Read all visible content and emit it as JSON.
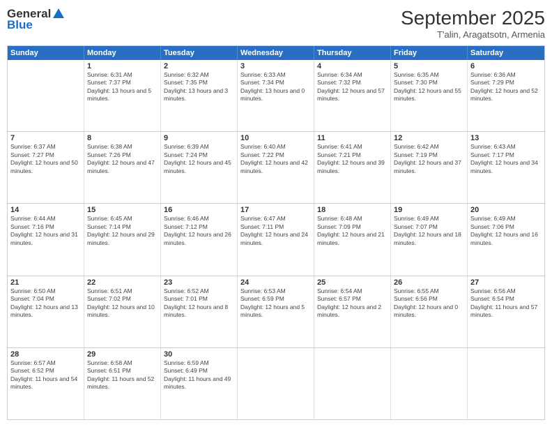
{
  "logo": {
    "general": "General",
    "blue": "Blue"
  },
  "title": "September 2025",
  "subtitle": "T'alin, Aragatsotn, Armenia",
  "days": [
    "Sunday",
    "Monday",
    "Tuesday",
    "Wednesday",
    "Thursday",
    "Friday",
    "Saturday"
  ],
  "weeks": [
    [
      {
        "num": "",
        "sunrise": "",
        "sunset": "",
        "daylight": ""
      },
      {
        "num": "1",
        "sunrise": "Sunrise: 6:31 AM",
        "sunset": "Sunset: 7:37 PM",
        "daylight": "Daylight: 13 hours and 5 minutes."
      },
      {
        "num": "2",
        "sunrise": "Sunrise: 6:32 AM",
        "sunset": "Sunset: 7:35 PM",
        "daylight": "Daylight: 13 hours and 3 minutes."
      },
      {
        "num": "3",
        "sunrise": "Sunrise: 6:33 AM",
        "sunset": "Sunset: 7:34 PM",
        "daylight": "Daylight: 13 hours and 0 minutes."
      },
      {
        "num": "4",
        "sunrise": "Sunrise: 6:34 AM",
        "sunset": "Sunset: 7:32 PM",
        "daylight": "Daylight: 12 hours and 57 minutes."
      },
      {
        "num": "5",
        "sunrise": "Sunrise: 6:35 AM",
        "sunset": "Sunset: 7:30 PM",
        "daylight": "Daylight: 12 hours and 55 minutes."
      },
      {
        "num": "6",
        "sunrise": "Sunrise: 6:36 AM",
        "sunset": "Sunset: 7:29 PM",
        "daylight": "Daylight: 12 hours and 52 minutes."
      }
    ],
    [
      {
        "num": "7",
        "sunrise": "Sunrise: 6:37 AM",
        "sunset": "Sunset: 7:27 PM",
        "daylight": "Daylight: 12 hours and 50 minutes."
      },
      {
        "num": "8",
        "sunrise": "Sunrise: 6:38 AM",
        "sunset": "Sunset: 7:26 PM",
        "daylight": "Daylight: 12 hours and 47 minutes."
      },
      {
        "num": "9",
        "sunrise": "Sunrise: 6:39 AM",
        "sunset": "Sunset: 7:24 PM",
        "daylight": "Daylight: 12 hours and 45 minutes."
      },
      {
        "num": "10",
        "sunrise": "Sunrise: 6:40 AM",
        "sunset": "Sunset: 7:22 PM",
        "daylight": "Daylight: 12 hours and 42 minutes."
      },
      {
        "num": "11",
        "sunrise": "Sunrise: 6:41 AM",
        "sunset": "Sunset: 7:21 PM",
        "daylight": "Daylight: 12 hours and 39 minutes."
      },
      {
        "num": "12",
        "sunrise": "Sunrise: 6:42 AM",
        "sunset": "Sunset: 7:19 PM",
        "daylight": "Daylight: 12 hours and 37 minutes."
      },
      {
        "num": "13",
        "sunrise": "Sunrise: 6:43 AM",
        "sunset": "Sunset: 7:17 PM",
        "daylight": "Daylight: 12 hours and 34 minutes."
      }
    ],
    [
      {
        "num": "14",
        "sunrise": "Sunrise: 6:44 AM",
        "sunset": "Sunset: 7:16 PM",
        "daylight": "Daylight: 12 hours and 31 minutes."
      },
      {
        "num": "15",
        "sunrise": "Sunrise: 6:45 AM",
        "sunset": "Sunset: 7:14 PM",
        "daylight": "Daylight: 12 hours and 29 minutes."
      },
      {
        "num": "16",
        "sunrise": "Sunrise: 6:46 AM",
        "sunset": "Sunset: 7:12 PM",
        "daylight": "Daylight: 12 hours and 26 minutes."
      },
      {
        "num": "17",
        "sunrise": "Sunrise: 6:47 AM",
        "sunset": "Sunset: 7:11 PM",
        "daylight": "Daylight: 12 hours and 24 minutes."
      },
      {
        "num": "18",
        "sunrise": "Sunrise: 6:48 AM",
        "sunset": "Sunset: 7:09 PM",
        "daylight": "Daylight: 12 hours and 21 minutes."
      },
      {
        "num": "19",
        "sunrise": "Sunrise: 6:49 AM",
        "sunset": "Sunset: 7:07 PM",
        "daylight": "Daylight: 12 hours and 18 minutes."
      },
      {
        "num": "20",
        "sunrise": "Sunrise: 6:49 AM",
        "sunset": "Sunset: 7:06 PM",
        "daylight": "Daylight: 12 hours and 16 minutes."
      }
    ],
    [
      {
        "num": "21",
        "sunrise": "Sunrise: 6:50 AM",
        "sunset": "Sunset: 7:04 PM",
        "daylight": "Daylight: 12 hours and 13 minutes."
      },
      {
        "num": "22",
        "sunrise": "Sunrise: 6:51 AM",
        "sunset": "Sunset: 7:02 PM",
        "daylight": "Daylight: 12 hours and 10 minutes."
      },
      {
        "num": "23",
        "sunrise": "Sunrise: 6:52 AM",
        "sunset": "Sunset: 7:01 PM",
        "daylight": "Daylight: 12 hours and 8 minutes."
      },
      {
        "num": "24",
        "sunrise": "Sunrise: 6:53 AM",
        "sunset": "Sunset: 6:59 PM",
        "daylight": "Daylight: 12 hours and 5 minutes."
      },
      {
        "num": "25",
        "sunrise": "Sunrise: 6:54 AM",
        "sunset": "Sunset: 6:57 PM",
        "daylight": "Daylight: 12 hours and 2 minutes."
      },
      {
        "num": "26",
        "sunrise": "Sunrise: 6:55 AM",
        "sunset": "Sunset: 6:56 PM",
        "daylight": "Daylight: 12 hours and 0 minutes."
      },
      {
        "num": "27",
        "sunrise": "Sunrise: 6:56 AM",
        "sunset": "Sunset: 6:54 PM",
        "daylight": "Daylight: 11 hours and 57 minutes."
      }
    ],
    [
      {
        "num": "28",
        "sunrise": "Sunrise: 6:57 AM",
        "sunset": "Sunset: 6:52 PM",
        "daylight": "Daylight: 11 hours and 54 minutes."
      },
      {
        "num": "29",
        "sunrise": "Sunrise: 6:58 AM",
        "sunset": "Sunset: 6:51 PM",
        "daylight": "Daylight: 11 hours and 52 minutes."
      },
      {
        "num": "30",
        "sunrise": "Sunrise: 6:59 AM",
        "sunset": "Sunset: 6:49 PM",
        "daylight": "Daylight: 11 hours and 49 minutes."
      },
      {
        "num": "",
        "sunrise": "",
        "sunset": "",
        "daylight": ""
      },
      {
        "num": "",
        "sunrise": "",
        "sunset": "",
        "daylight": ""
      },
      {
        "num": "",
        "sunrise": "",
        "sunset": "",
        "daylight": ""
      },
      {
        "num": "",
        "sunrise": "",
        "sunset": "",
        "daylight": ""
      }
    ]
  ]
}
